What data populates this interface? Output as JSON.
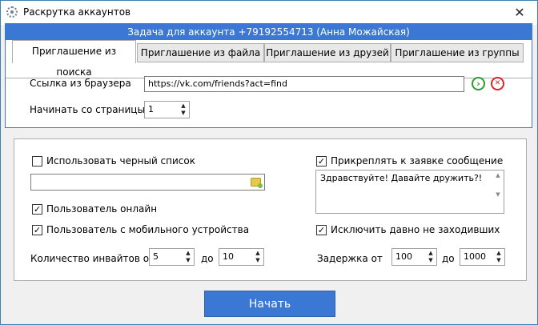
{
  "window": {
    "title": "Раскрутка аккаунтов",
    "close_glyph": "✕"
  },
  "task_header": "Задача для аккаунта +79192554713 (Анна Можайская)",
  "tabs": [
    {
      "label": "Приглашение из поиска",
      "active": true
    },
    {
      "label": "Приглашение из файла",
      "active": false
    },
    {
      "label": "Приглашение из друзей",
      "active": false
    },
    {
      "label": "Приглашение из группы",
      "active": false
    }
  ],
  "search_tab": {
    "url_label": "Ссылка из браузера",
    "url_value": "https://vk.com/friends?act=find",
    "start_page_label": "Начинать со страницы",
    "start_page_value": "1",
    "go_glyph": "›",
    "clear_glyph": "✕"
  },
  "options": {
    "blacklist_label": "Использовать черный список",
    "blacklist_checked": false,
    "blacklist_path": "",
    "online_label": "Пользователь онлайн",
    "online_checked": true,
    "mobile_label": "Пользователь с мобильного устройства",
    "mobile_checked": true,
    "invites_label": "Количество инвайтов от",
    "invites_from": "5",
    "invites_to_label": "до",
    "invites_to": "10",
    "attach_message_label": "Прикреплять к заявке сообщение",
    "attach_message_checked": true,
    "message_text": "Здравствуйте! Давайте дружить?!",
    "exclude_inactive_label": "Исключить давно не заходивших",
    "exclude_inactive_checked": true,
    "delay_label": "Задержка от",
    "delay_from": "100",
    "delay_to_label": "до",
    "delay_to": "1000"
  },
  "start_button": "Начать",
  "colors": {
    "accent": "#3a78d3",
    "go_green": "#2e9b2e",
    "clear_red": "#d9262b"
  }
}
